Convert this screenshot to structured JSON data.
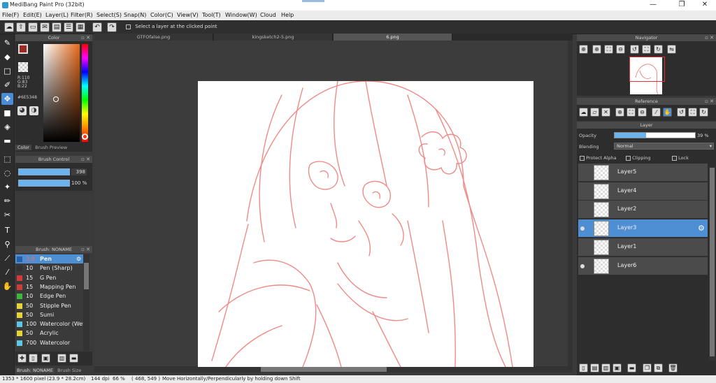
{
  "app": {
    "title": "MediBang Paint Pro (32bit)"
  },
  "window_controls": {
    "minimize": "—",
    "maximize": "❐",
    "close": "✕"
  },
  "menu": [
    "File(F)",
    "Edit(E)",
    "Layer(L)",
    "Filter(R)",
    "Select(S)",
    "Snap(N)",
    "Color(C)",
    "View(V)",
    "Tool(T)",
    "Window(W)",
    "Cloud",
    "Help"
  ],
  "toolbar": {
    "select_layer_label": "Select a layer at the clicked point",
    "select_layer_checked": false
  },
  "tabs": [
    {
      "label": "GTFOfalse.png",
      "active": false
    },
    {
      "label": "kingsketch2-5.png",
      "active": false
    },
    {
      "label": "6.png",
      "active": true
    }
  ],
  "color_panel": {
    "title": "Color",
    "rgb": [
      "R:110",
      "G:83",
      "B:22"
    ],
    "hex": "#6E5348",
    "tabs": [
      "Color",
      "Brush Preview"
    ],
    "primary_color": "#9b2a22"
  },
  "brush_control": {
    "title": "Brush Control",
    "size_value": "398",
    "opacity_value": "100 %"
  },
  "brush_panel": {
    "title": "Brush: NONAME",
    "items": [
      {
        "size": "3.8",
        "name": "Pen",
        "color": "#2a5fa8",
        "selected": true
      },
      {
        "size": "10",
        "name": "Pen (Sharp)",
        "color": "#333333",
        "selected": false
      },
      {
        "size": "15",
        "name": "G Pen",
        "color": "#d23b3b",
        "selected": false
      },
      {
        "size": "15",
        "name": "Mapping Pen",
        "color": "#d23b3b",
        "selected": false
      },
      {
        "size": "10",
        "name": "Edge Pen",
        "color": "#3cb93c",
        "selected": false
      },
      {
        "size": "50",
        "name": "Stipple Pen",
        "color": "#e6d23a",
        "selected": false
      },
      {
        "size": "50",
        "name": "Sumi",
        "color": "#e6d23a",
        "selected": false
      },
      {
        "size": "100",
        "name": "Watercolor (Wet",
        "color": "#5cc8e6",
        "selected": false
      },
      {
        "size": "50",
        "name": "Acrylic",
        "color": "#e6d23a",
        "selected": false
      },
      {
        "size": "700",
        "name": "Watercolor",
        "color": "#5cc8e6",
        "selected": false
      }
    ],
    "bottom_tabs": [
      "Brush: NONAME",
      "Brush Size"
    ]
  },
  "navigator": {
    "title": "Navigator"
  },
  "reference": {
    "title": "Reference"
  },
  "layer_panel": {
    "title": "Layer",
    "opacity_label": "Opacity",
    "opacity_value": "39 %",
    "opacity_fraction": 0.39,
    "blending_label": "Blending",
    "blending_value": "Normal",
    "protect_alpha": "Protect Alpha",
    "clipping": "Clipping",
    "lock": "Lock",
    "layers": [
      {
        "name": "Layer5",
        "visible": false,
        "selected": false
      },
      {
        "name": "Layer4",
        "visible": false,
        "selected": false
      },
      {
        "name": "Layer2",
        "visible": false,
        "selected": false
      },
      {
        "name": "Layer3",
        "visible": true,
        "selected": true
      },
      {
        "name": "Layer1",
        "visible": false,
        "selected": false
      },
      {
        "name": "Layer6",
        "visible": true,
        "selected": false
      }
    ]
  },
  "status": {
    "size": "1353 * 1600 pixel",
    "cm": "(23.9 * 28.2cm)",
    "dpi": "144 dpi",
    "zoom": "66 %",
    "coords": "( 468, 549 )",
    "hint": "Move Horizontally/Perpendicularly by holding down Shift"
  },
  "colors": {
    "accent": "#4e8fd4",
    "sketch": "#f08a86",
    "bg": "#3a3a3a"
  }
}
